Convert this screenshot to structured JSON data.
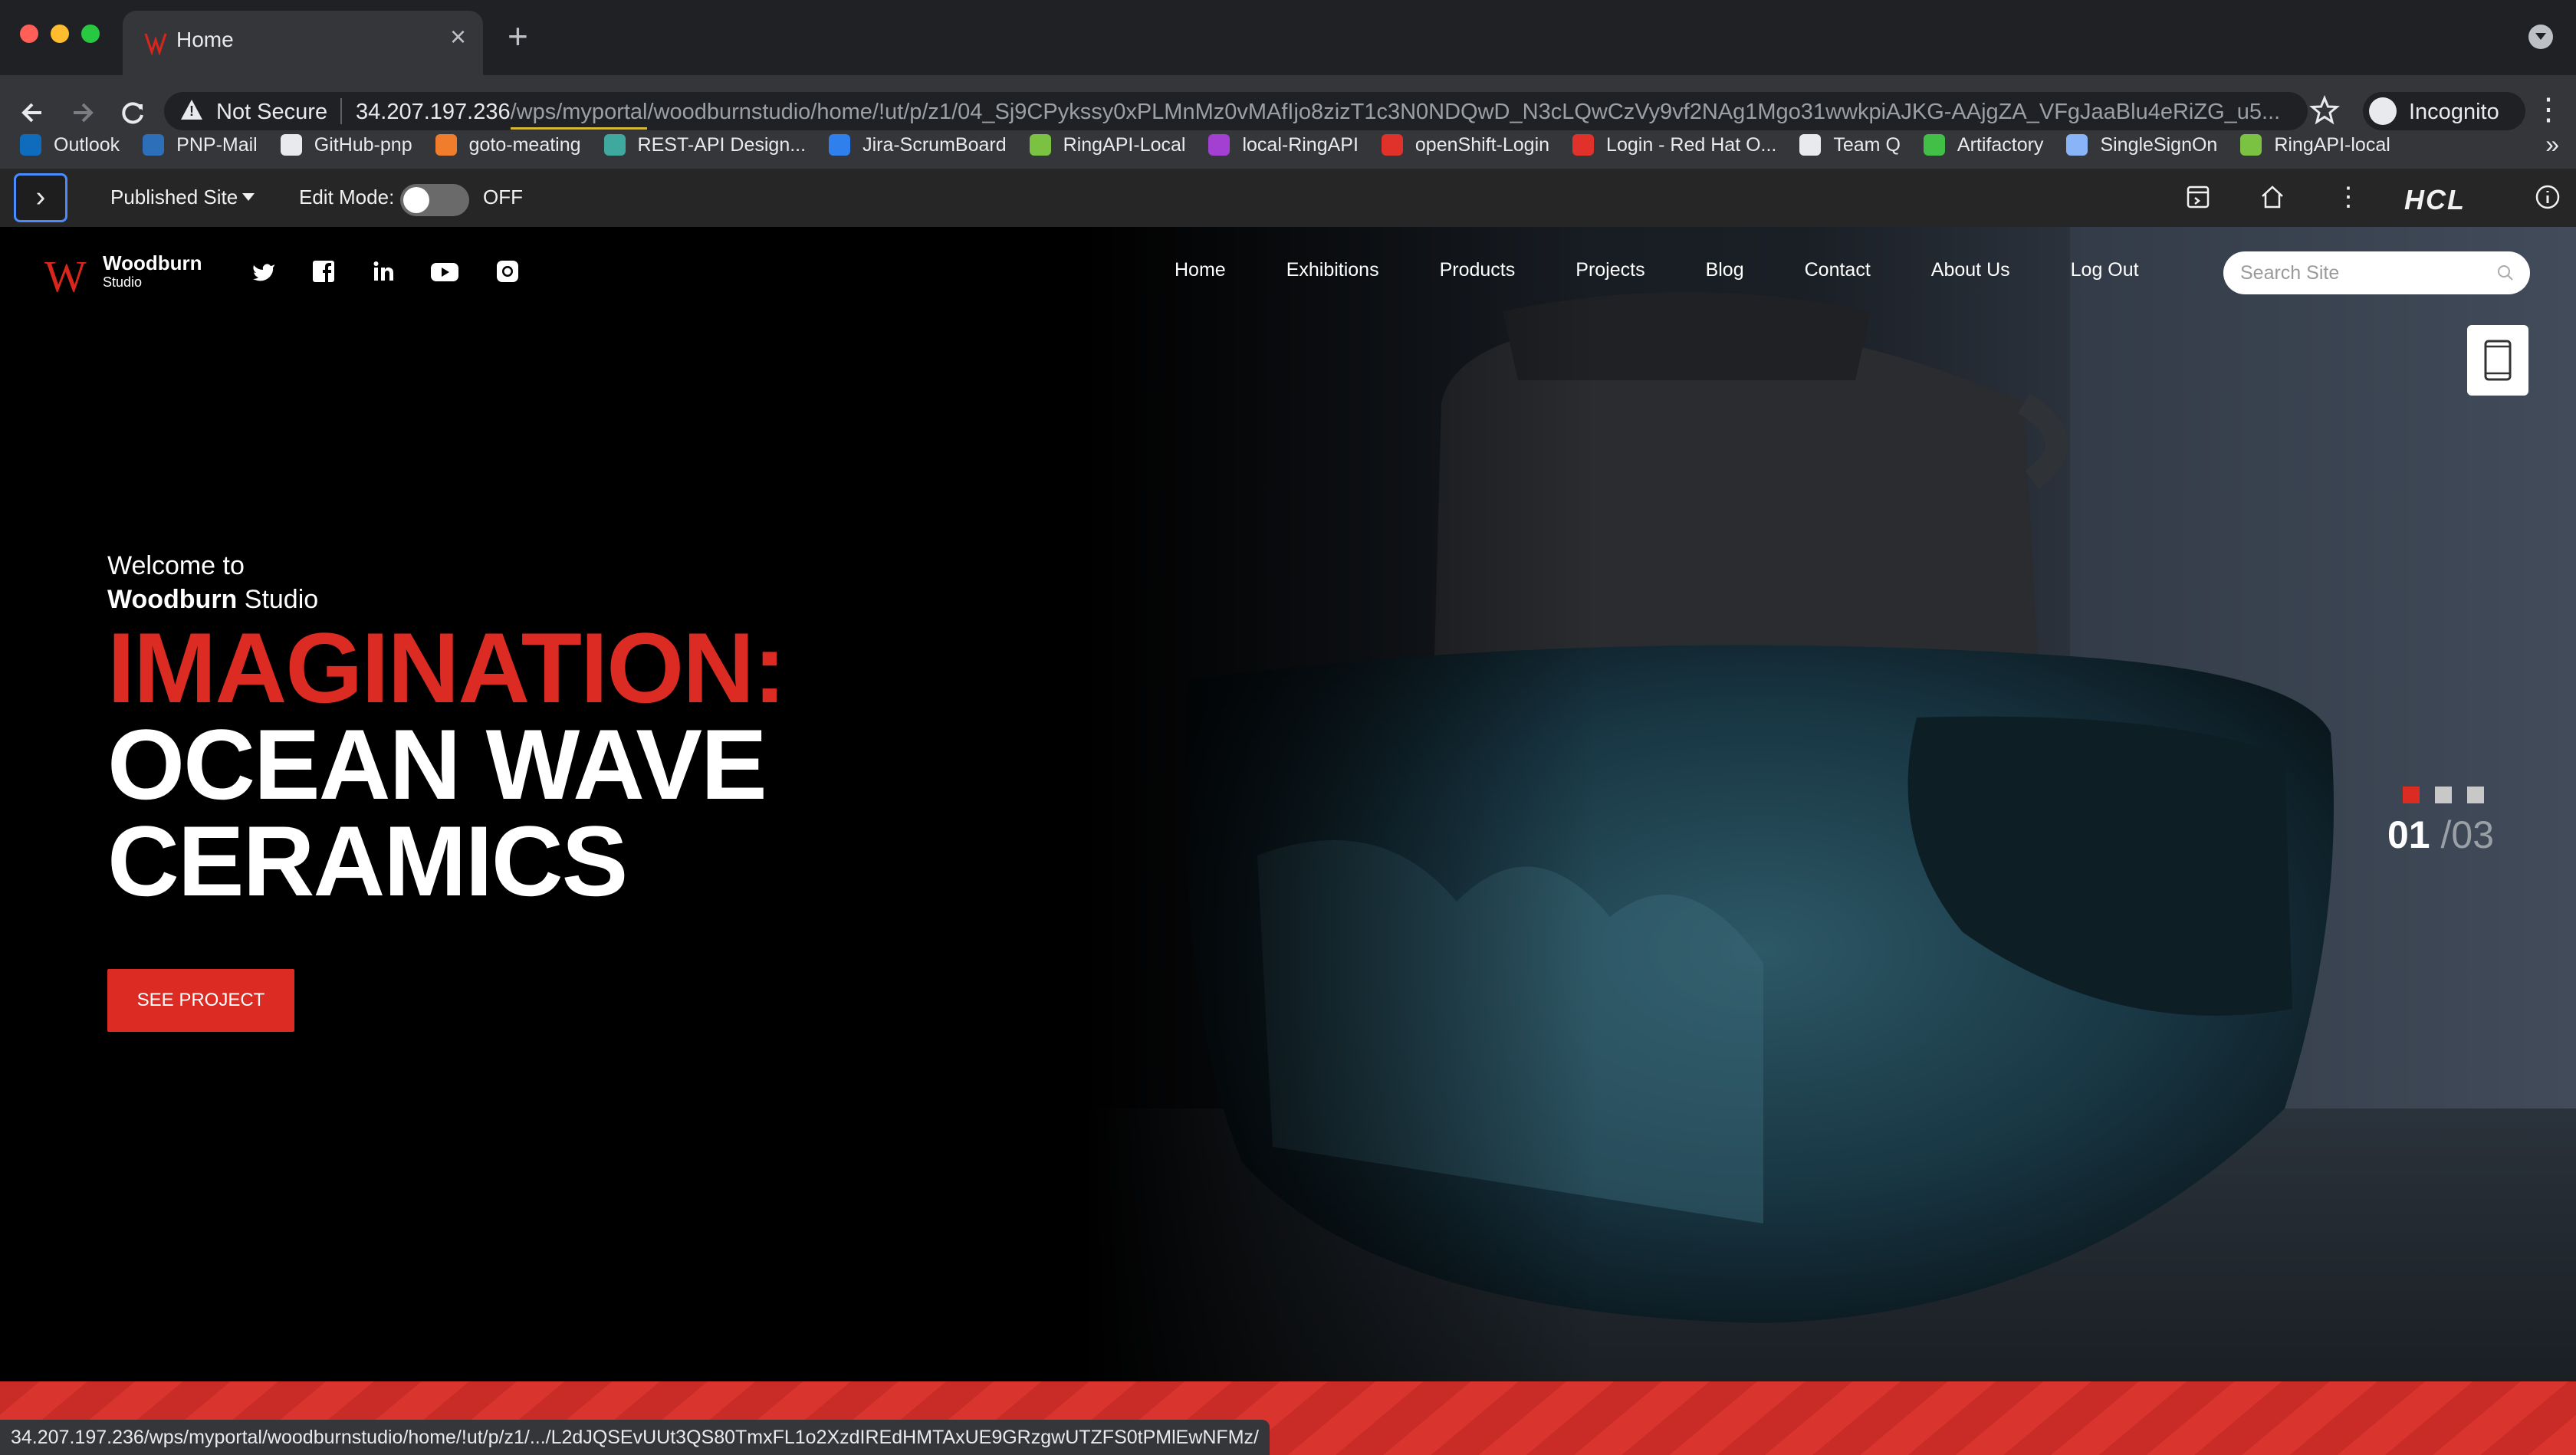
{
  "browser": {
    "tab_title": "Home",
    "new_tab_symbol": "+",
    "close_symbol": "×",
    "security_label": "Not Secure",
    "url_host": "34.207.197.236",
    "url_path": "/wps/myportal/woodburnstudio/home/!ut/p/z1/04_Sj9CPykssy0xPLMnMz0vMAfIjo8zizT1c3N0NDQwD_N3cLQwCzVy9vf2NAg1Mgo31wwkpiAJKG-AAjgZA_VFgJaaBlu4eRiZG_u5...",
    "incognito_label": "Incognito",
    "status_url": "34.207.197.236/wps/myportal/woodburnstudio/home/!ut/p/z1/.../L2dJQSEvUUt3QS80TmxFL1o2XzdIREdHMTAxUE9GRzgwUTZFS0tPMlEwNFMz/",
    "colors": {
      "chrome_dark": "#202124",
      "chrome_mid": "#35363a",
      "accent_underline": "#d7b93a"
    }
  },
  "bookmarks": [
    {
      "label": "Outlook",
      "icon": "outlook-icon",
      "color": "#0f6cbd"
    },
    {
      "label": "PNP-Mail",
      "icon": "paper-plane-icon",
      "color": "#2d6fb8"
    },
    {
      "label": "GitHub-pnp",
      "icon": "github-icon",
      "color": "#e8eaed"
    },
    {
      "label": "goto-meating",
      "icon": "goto-icon",
      "color": "#f07d2b"
    },
    {
      "label": "REST-API Design...",
      "icon": "rest-api-icon",
      "color": "#3fa9a0"
    },
    {
      "label": "Jira-ScrumBoard",
      "icon": "jira-icon",
      "color": "#2f80ed"
    },
    {
      "label": "RingAPI-Local",
      "icon": "ring-icon",
      "color": "#7cc242"
    },
    {
      "label": "local-RingAPI",
      "icon": "local-ring-icon",
      "color": "#a33fd1"
    },
    {
      "label": "openShift-Login",
      "icon": "openshift-icon",
      "color": "#e0312b"
    },
    {
      "label": "Login - Red Hat O...",
      "icon": "redhat-icon",
      "color": "#e0312b"
    },
    {
      "label": "Team Q",
      "icon": "github-icon",
      "color": "#e8eaed"
    },
    {
      "label": "Artifactory",
      "icon": "artifactory-icon",
      "color": "#41bf47"
    },
    {
      "label": "SingleSignOn",
      "icon": "sso-icon",
      "color": "#8ab4f8"
    },
    {
      "label": "RingAPI-local",
      "icon": "ring-icon",
      "color": "#7cc242"
    }
  ],
  "bookmarks_more": "»",
  "dx": {
    "site_select": "Published Site",
    "edit_mode_label": "Edit Mode:",
    "edit_mode_state": "OFF",
    "brand_logo": "HCL"
  },
  "site": {
    "logo_letter": "W",
    "logo_name": "Woodburn",
    "logo_sub": "Studio",
    "social": [
      "twitter-icon",
      "facebook-icon",
      "linkedin-icon",
      "youtube-icon",
      "instagram-icon"
    ],
    "nav": [
      "Home",
      "Exhibitions",
      "Products",
      "Projects",
      "Blog",
      "Contact",
      "About Us",
      "Log Out"
    ],
    "search_placeholder": "Search Site",
    "hero": {
      "welcome": "Welcome to",
      "brand_bold": "Woodburn",
      "brand_rest": " Studio",
      "line1": "IMAGINATION:",
      "line2": "OCEAN WAVE",
      "line3": "CERAMICS",
      "cta": "SEE PROJECT"
    },
    "slider": {
      "current": "01",
      "total": "/03",
      "active_index": 0,
      "count": 3
    },
    "colors": {
      "brand_red": "#dc2b22",
      "dot_inactive": "#c8c8c8"
    }
  }
}
